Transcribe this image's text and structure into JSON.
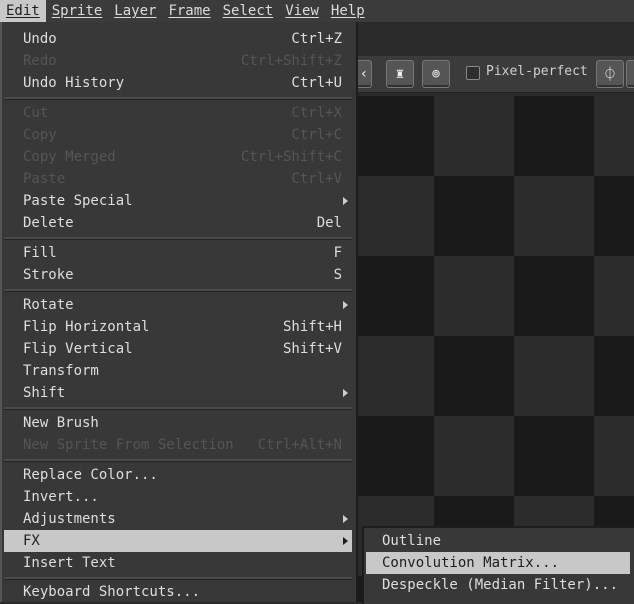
{
  "menubar": {
    "items": [
      "Edit",
      "Sprite",
      "Layer",
      "Frame",
      "Select",
      "View",
      "Help"
    ],
    "active": "Edit"
  },
  "toolbar": {
    "pixel_perfect_label": "Pixel-perfect",
    "pixel_perfect_checked": false,
    "icons": [
      "chevron-left-icon",
      "ink-icon",
      "pattern-icon",
      "symmetry-icon"
    ]
  },
  "edit_menu": {
    "items": [
      {
        "label": "Undo",
        "shortcut": "Ctrl+Z",
        "enabled": true
      },
      {
        "label": "Redo",
        "shortcut": "Ctrl+Shift+Z",
        "enabled": false
      },
      {
        "label": "Undo History",
        "shortcut": "Ctrl+U",
        "enabled": true
      },
      {
        "label": "Cut",
        "shortcut": "Ctrl+X",
        "enabled": false
      },
      {
        "label": "Copy",
        "shortcut": "Ctrl+C",
        "enabled": false
      },
      {
        "label": "Copy Merged",
        "shortcut": "Ctrl+Shift+C",
        "enabled": false
      },
      {
        "label": "Paste",
        "shortcut": "Ctrl+V",
        "enabled": false
      },
      {
        "label": "Paste Special",
        "shortcut": "",
        "enabled": true,
        "submenu": true
      },
      {
        "label": "Delete",
        "shortcut": "Del",
        "enabled": true
      },
      {
        "label": "Fill",
        "shortcut": "F",
        "enabled": true
      },
      {
        "label": "Stroke",
        "shortcut": "S",
        "enabled": true
      },
      {
        "label": "Rotate",
        "shortcut": "",
        "enabled": true,
        "submenu": true
      },
      {
        "label": "Flip Horizontal",
        "shortcut": "Shift+H",
        "enabled": true
      },
      {
        "label": "Flip Vertical",
        "shortcut": "Shift+V",
        "enabled": true
      },
      {
        "label": "Transform",
        "shortcut": "",
        "enabled": true
      },
      {
        "label": "Shift",
        "shortcut": "",
        "enabled": true,
        "submenu": true
      },
      {
        "label": "New Brush",
        "shortcut": "",
        "enabled": true
      },
      {
        "label": "New Sprite From Selection",
        "shortcut": "Ctrl+Alt+N",
        "enabled": false
      },
      {
        "label": "Replace Color...",
        "shortcut": "",
        "enabled": true
      },
      {
        "label": "Invert...",
        "shortcut": "",
        "enabled": true
      },
      {
        "label": "Adjustments",
        "shortcut": "",
        "enabled": true,
        "submenu": true
      },
      {
        "label": "FX",
        "shortcut": "",
        "enabled": true,
        "submenu": true,
        "highlight": true
      },
      {
        "label": "Insert Text",
        "shortcut": "",
        "enabled": true
      },
      {
        "label": "Keyboard Shortcuts...",
        "shortcut": "",
        "enabled": true
      }
    ]
  },
  "fx_submenu": {
    "items": [
      {
        "label": "Outline",
        "highlight": false
      },
      {
        "label": "Convolution Matrix...",
        "highlight": true
      },
      {
        "label": "Despeckle (Median Filter)...",
        "highlight": false
      }
    ]
  }
}
